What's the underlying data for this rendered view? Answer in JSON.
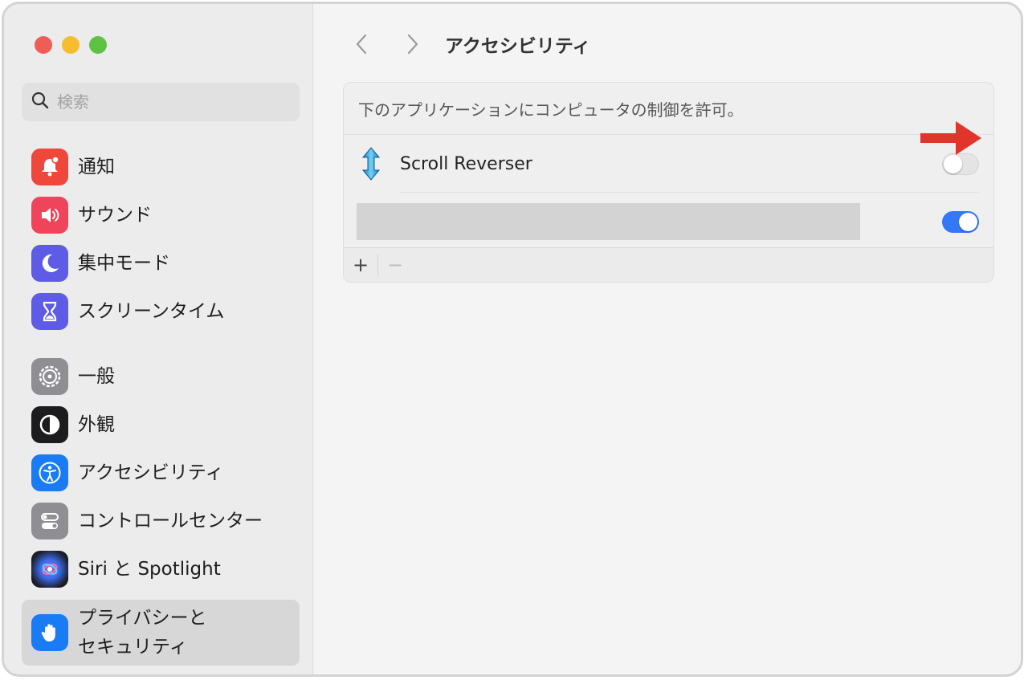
{
  "window": {
    "traffic_lights": [
      "close",
      "minimize",
      "zoom"
    ]
  },
  "sidebar": {
    "search": {
      "placeholder": "検索",
      "value": ""
    },
    "items": [
      {
        "label": "通知",
        "icon": "bell-badge-icon",
        "color": "#f0473c"
      },
      {
        "label": "サウンド",
        "icon": "speaker-icon",
        "color": "#f0445a"
      },
      {
        "label": "集中モード",
        "icon": "moon-icon",
        "color": "#5e5ce6"
      },
      {
        "label": "スクリーンタイム",
        "icon": "hourglass-icon",
        "color": "#5e5ce6"
      },
      {
        "label": "一般",
        "icon": "gear-icon",
        "color": "#8e8e93"
      },
      {
        "label": "外観",
        "icon": "appearance-icon",
        "color": "#1c1c1e"
      },
      {
        "label": "アクセシビリティ",
        "icon": "accessibility-icon",
        "color": "#1a7cf5"
      },
      {
        "label": "コントロールセンター",
        "icon": "control-center-icon",
        "color": "#8e8e93"
      },
      {
        "label": "Siri と Spotlight",
        "icon": "siri-icon",
        "color": "#2b2b3a"
      },
      {
        "label": "プライバシーと\nセキュリティ",
        "icon": "hand-icon",
        "color": "#1a7cf5",
        "selected": true
      }
    ]
  },
  "main": {
    "title": "アクセシビリティ",
    "panel_header": "下のアプリケーションにコンピュータの制御を許可。",
    "apps": [
      {
        "name": "Scroll Reverser",
        "enabled": false
      },
      {
        "name": "",
        "enabled": true,
        "redacted": true
      }
    ],
    "footer_buttons": [
      "+",
      "−"
    ]
  },
  "colors": {
    "accent": "#3478f6",
    "annotation_arrow": "#e0352b"
  }
}
